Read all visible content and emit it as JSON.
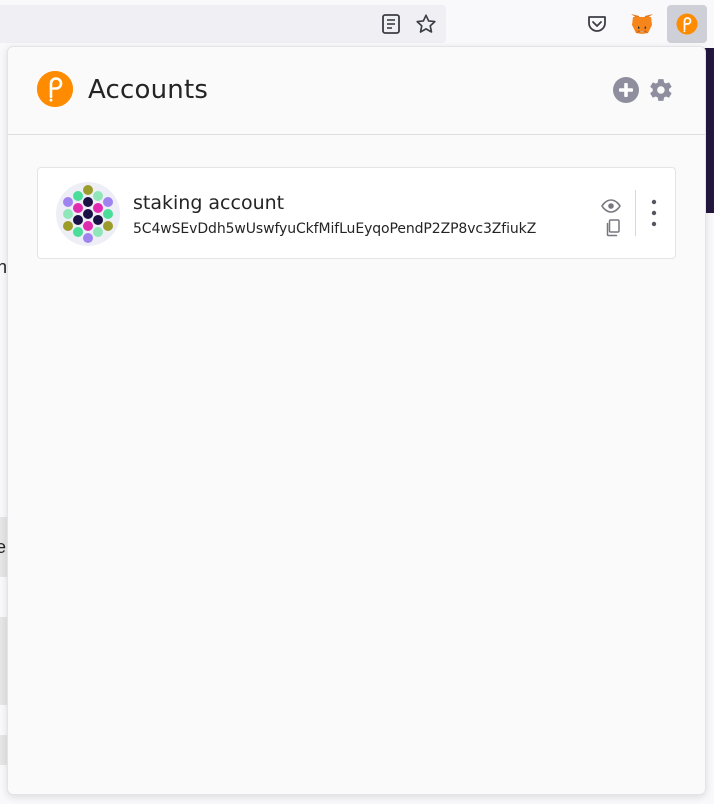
{
  "browser_toolbar": {
    "icons": [
      "reader-view-icon",
      "bookmark-star-icon",
      "pocket-icon",
      "metamask-fox-icon",
      "polkadot-extension-icon"
    ]
  },
  "background_page": {
    "fragments": [
      "n",
      "e",
      "i"
    ]
  },
  "popup": {
    "title": "Accounts",
    "header_icons": [
      "polkadot-logo-icon",
      "add-account-icon",
      "settings-gear-icon"
    ],
    "accent_color": "#ff8c00",
    "icon_color": "#8e8e9e"
  },
  "accounts": [
    {
      "name": "staking account",
      "address": "5C4wSEvDdh5wUswfyuCkfMifLuEyqoPendP2ZP8vc3ZfiukZ",
      "actions": [
        "eye-icon",
        "copy-icon",
        "more-vertical-icon"
      ]
    }
  ]
}
